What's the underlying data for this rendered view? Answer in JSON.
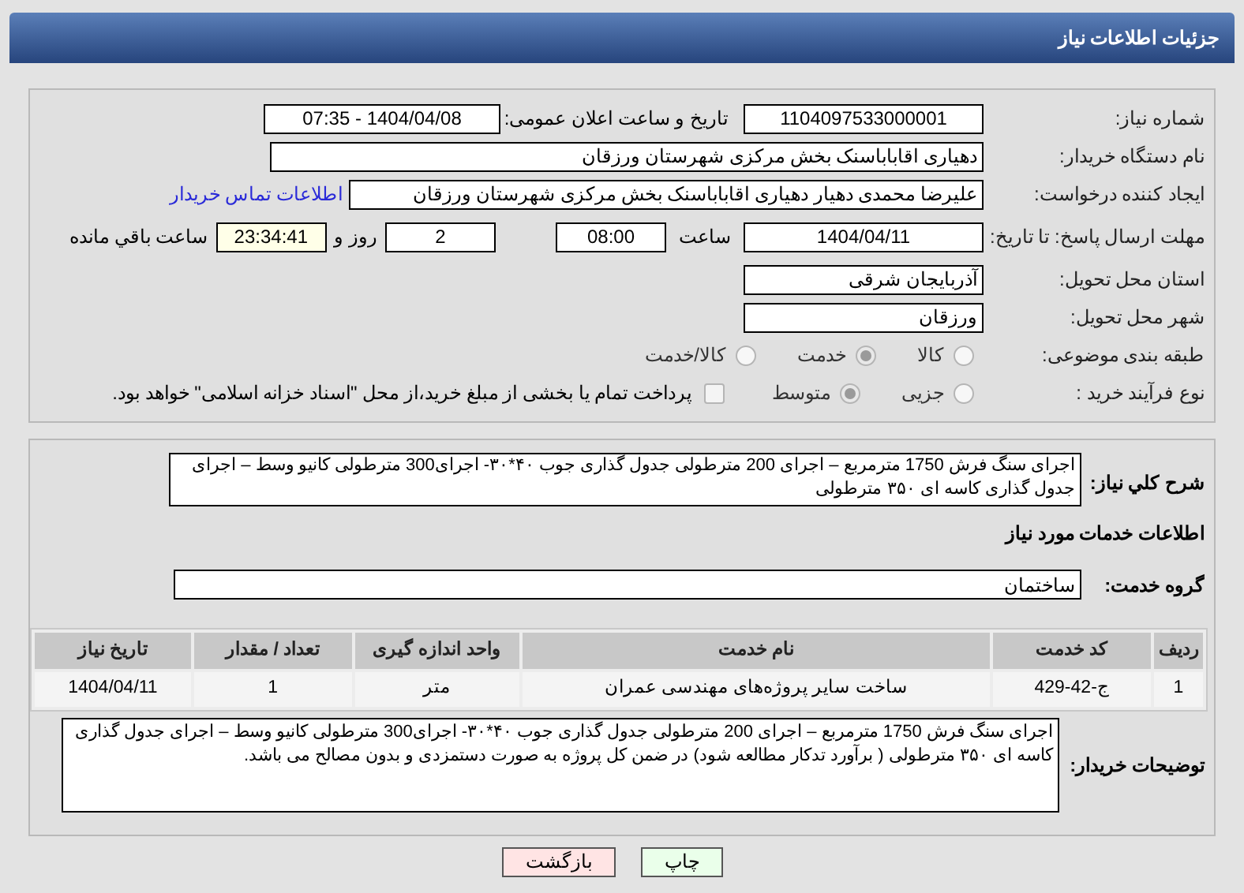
{
  "header": {
    "title": "جزئیات اطلاعات نیاز"
  },
  "details": {
    "need_number": {
      "label": "شماره نیاز:",
      "value": "1104097533000001"
    },
    "announce": {
      "label": "تاریخ و ساعت اعلان عمومی:",
      "value": "1404/04/08 - 07:35"
    },
    "buyer_org": {
      "label": "نام دستگاه خریدار:",
      "value": "دهیاری اقاباباسنک بخش مرکزی شهرستان ورزقان"
    },
    "requester": {
      "label": "ایجاد کننده درخواست:",
      "value": "علیرضا محمدی دهیار دهیاری اقاباباسنک بخش مرکزی شهرستان ورزقان",
      "link": "اطلاعات تماس خریدار"
    },
    "deadline": {
      "label": "مهلت ارسال پاسخ: تا تاریخ:",
      "date": "1404/04/11",
      "time_label": "ساعت",
      "time": "08:00",
      "days": "2",
      "days_label": "روز و",
      "remaining": "23:34:41",
      "remaining_label": "ساعت باقي مانده"
    },
    "province": {
      "label": "استان محل تحویل:",
      "value": "آذربایجان شرقی"
    },
    "city": {
      "label": "شهر محل تحویل:",
      "value": "ورزقان"
    },
    "category": {
      "label": "طبقه بندی موضوعی:",
      "options": [
        {
          "label": "کالا",
          "selected": false
        },
        {
          "label": "خدمت",
          "selected": true
        },
        {
          "label": "کالا/خدمت",
          "selected": false
        }
      ]
    },
    "process": {
      "label": "نوع فرآیند خرید :",
      "options": [
        {
          "label": "جزیی",
          "selected": false
        },
        {
          "label": "متوسط",
          "selected": true
        }
      ],
      "treasury": {
        "label": "پرداخت تمام یا بخشی از مبلغ خرید،از محل \"اسناد خزانه اسلامی\" خواهد بود.",
        "checked": false
      }
    }
  },
  "summary": {
    "label": "شرح کلي نیاز:",
    "value": "اجرای سنگ فرش  1750 مترمربع – اجرای 200 مترطولی جدول گذاری جوب ۴۰*۳۰- اجرای300  مترطولی کانیو وسط – اجرای جدول گذاری کاسه ای ۳۵۰ مترطولی"
  },
  "services": {
    "heading": "اطلاعات خدمات مورد نیاز",
    "group_label": "گروه خدمت:",
    "group": "ساختمان",
    "table": {
      "columns": [
        "ردیف",
        "کد خدمت",
        "نام خدمت",
        "واحد اندازه گیری",
        "تعداد / مقدار",
        "تاریخ نیاز"
      ],
      "rows": [
        [
          "1",
          "ج-42-429",
          "ساخت سایر پروژه‌های مهندسی عمران",
          "متر",
          "1",
          "1404/04/11"
        ]
      ]
    }
  },
  "buyer_notes": {
    "label": "توضیحات خریدار:",
    "value": "اجرای سنگ فرش  1750 مترمربع – اجرای 200 مترطولی جدول گذاری جوب ۴۰*۳۰- اجرای300  مترطولی کانیو وسط – اجرای جدول گذاری کاسه ای ۳۵۰ مترطولی ( برآورد تدکار مطالعه شود)    در ضمن کل پروژه به صورت دستمزدی و بدون مصالح می باشد."
  },
  "buttons": [
    {
      "kind": "print",
      "label": "چاپ"
    },
    {
      "kind": "back",
      "label": "بازگشت"
    }
  ]
}
